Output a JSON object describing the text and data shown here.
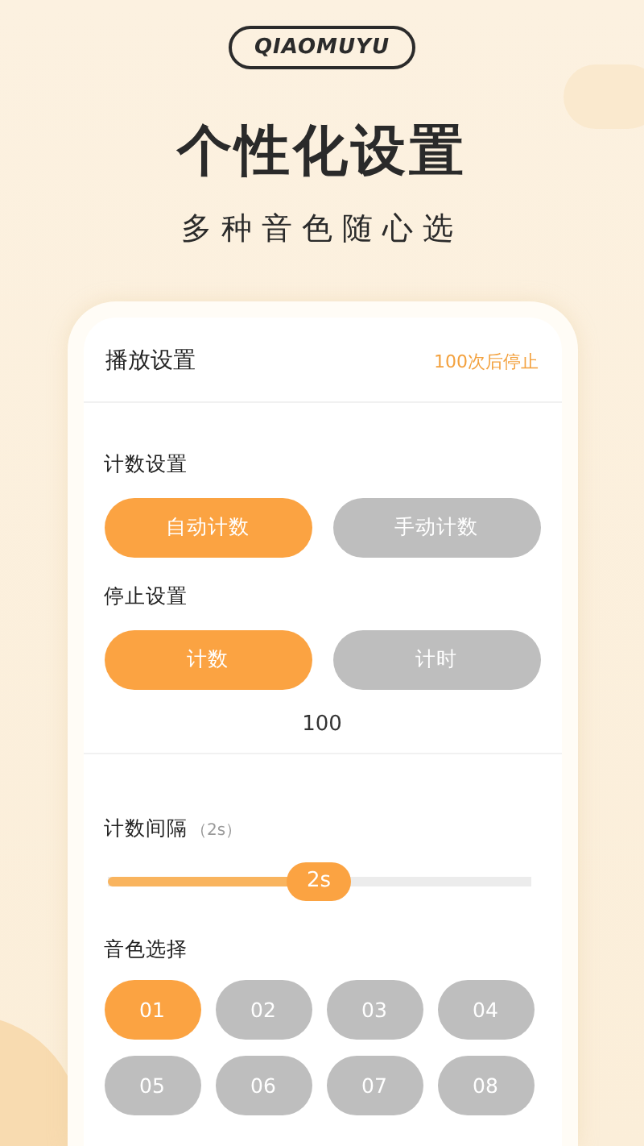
{
  "badge": "QIAOMUYU",
  "headline": "个性化设置",
  "subtitle": "多种音色随心选",
  "screen": {
    "title": "播放设置",
    "status": "100次后停止",
    "count_mode": {
      "label": "计数设置",
      "options": [
        {
          "label": "自动计数",
          "selected": true
        },
        {
          "label": "手动计数",
          "selected": false
        }
      ]
    },
    "stop_mode": {
      "label": "停止设置",
      "options": [
        {
          "label": "计数",
          "selected": true
        },
        {
          "label": "计时",
          "selected": false
        }
      ]
    },
    "stop_value": "100",
    "interval": {
      "label": "计数间隔",
      "hint": "（2s）",
      "level": 0.5,
      "reading": "2s"
    },
    "tone": {
      "label": "音色选择",
      "options": [
        {
          "label": "01",
          "selected": true
        },
        {
          "label": "02",
          "selected": false
        },
        {
          "label": "03",
          "selected": false
        },
        {
          "label": "04",
          "selected": false
        },
        {
          "label": "05",
          "selected": false
        },
        {
          "label": "06",
          "selected": false
        },
        {
          "label": "07",
          "selected": false
        },
        {
          "label": "08",
          "selected": false
        }
      ]
    }
  }
}
